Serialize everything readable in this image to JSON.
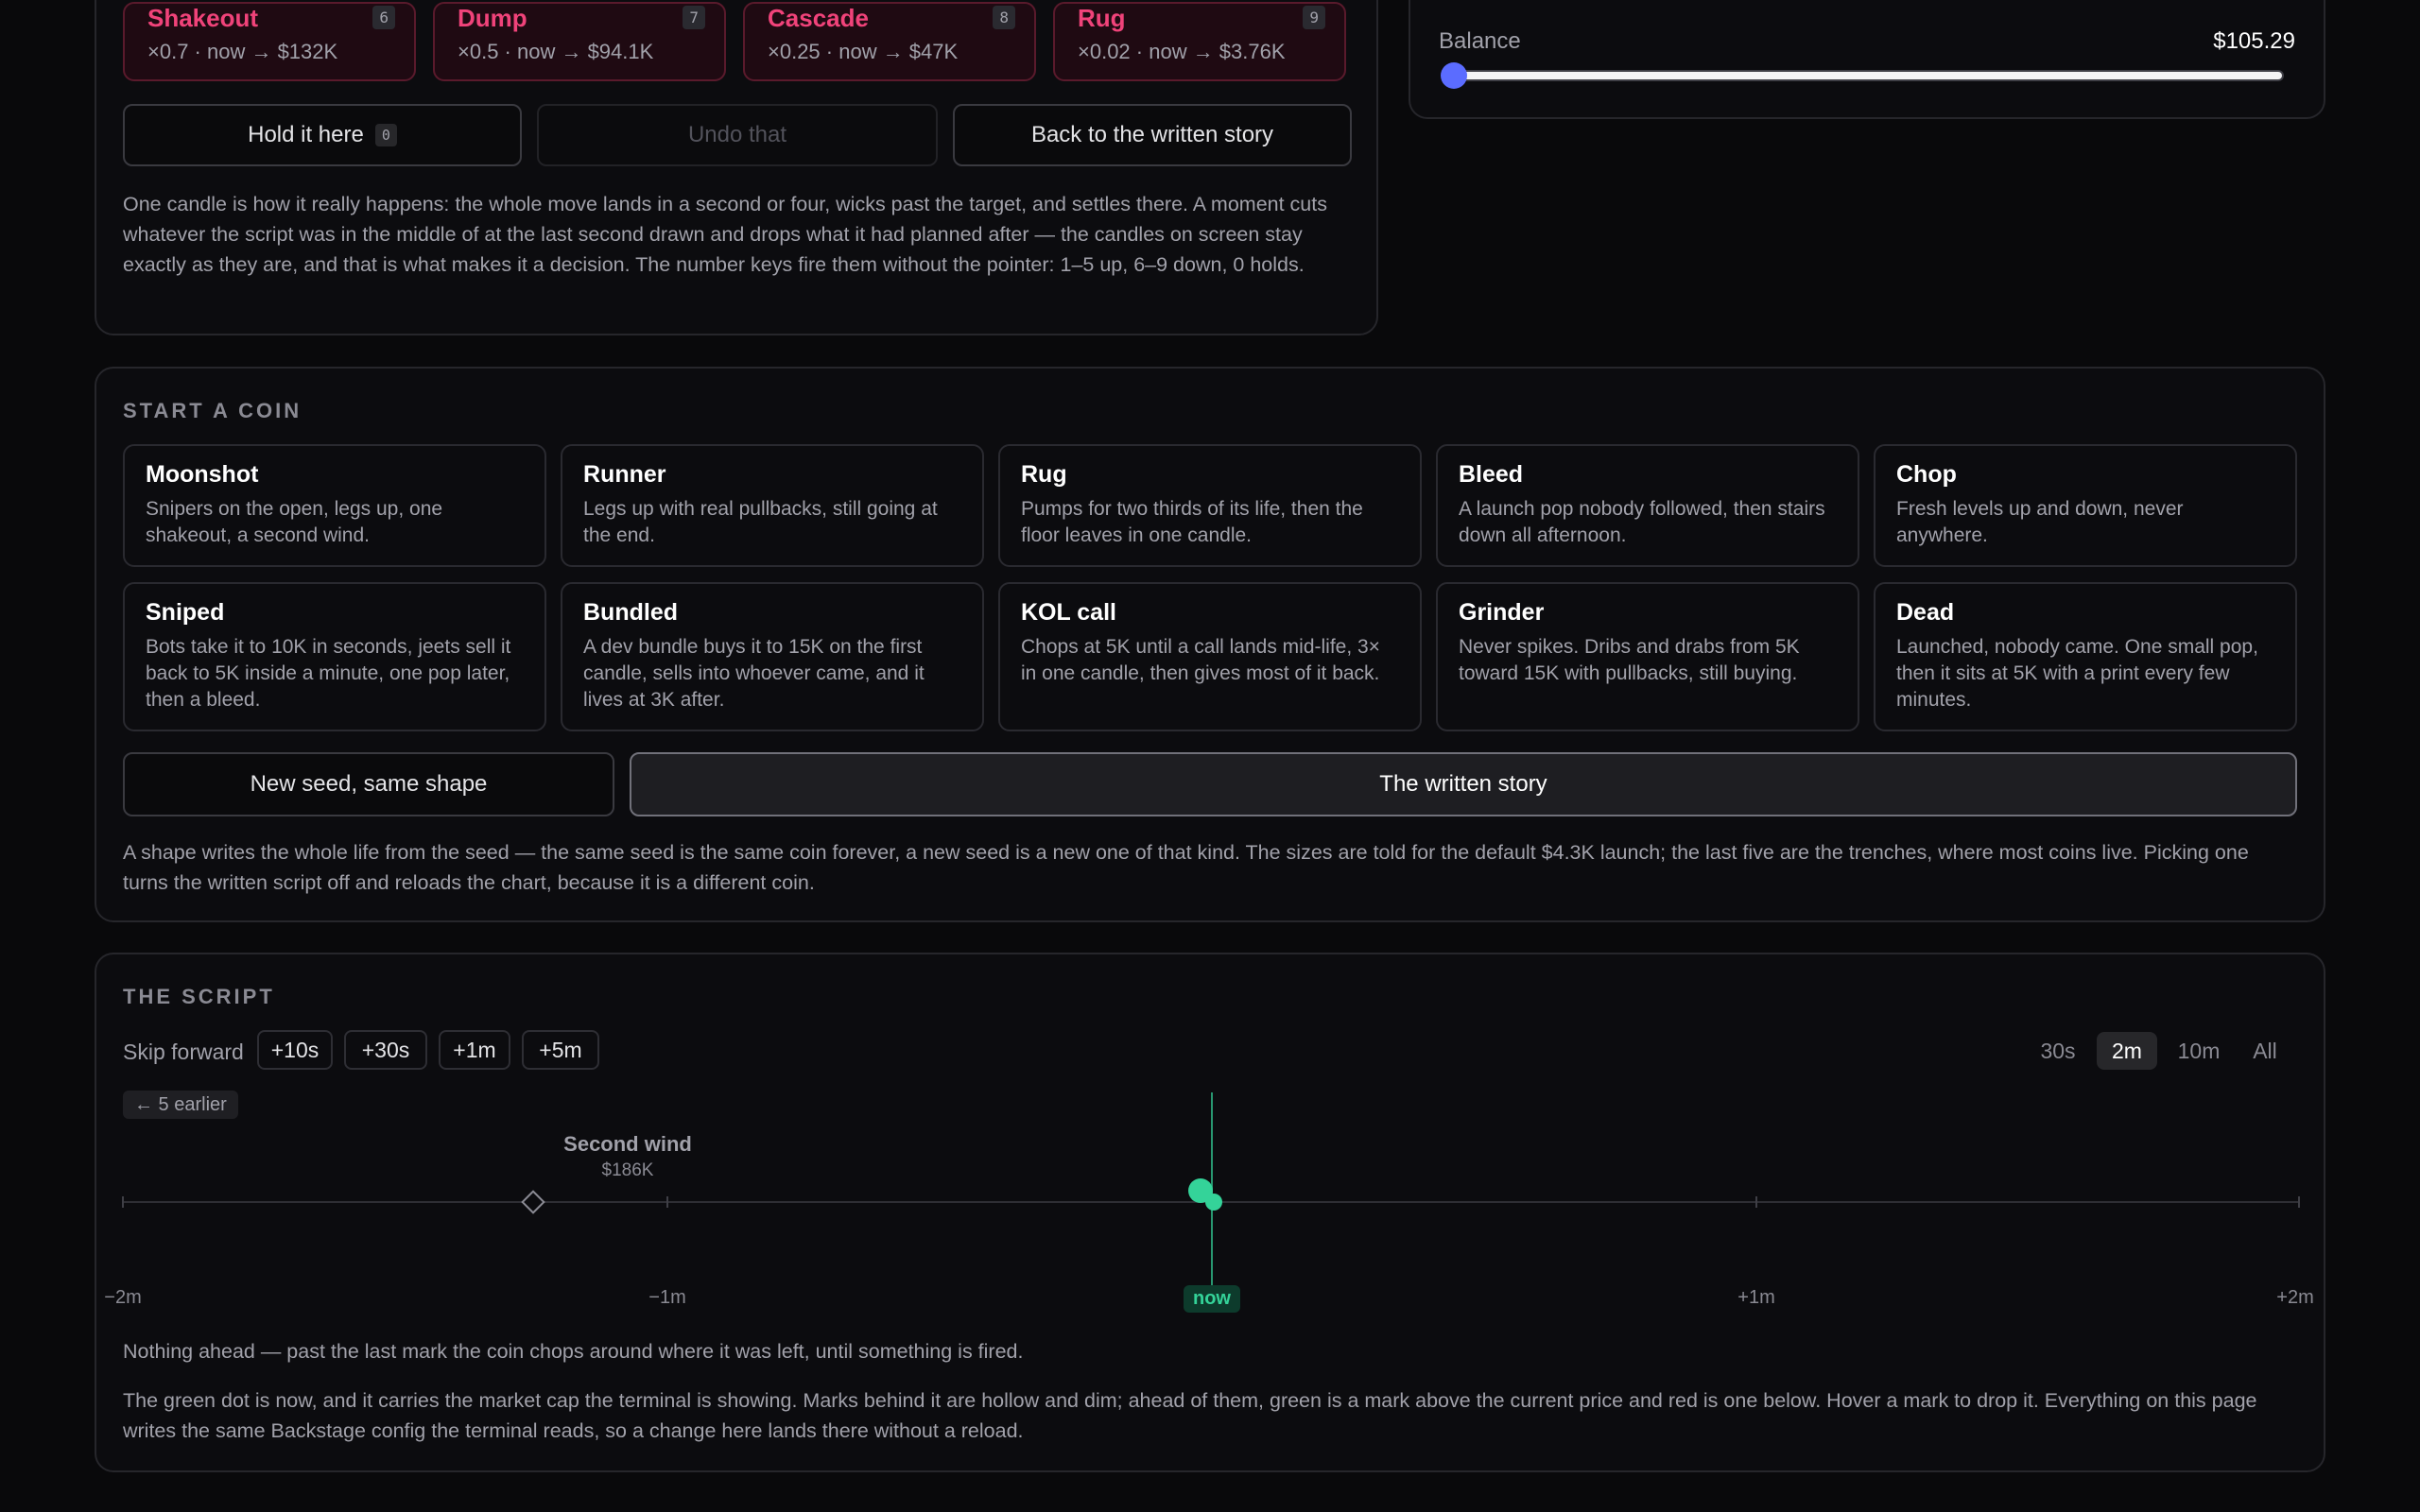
{
  "moments": [
    {
      "name": "Shakeout",
      "key": "6",
      "desc": "×0.7 · now → $132K"
    },
    {
      "name": "Dump",
      "key": "7",
      "desc": "×0.5 · now → $94.1K"
    },
    {
      "name": "Cascade",
      "key": "8",
      "desc": "×0.25 · now → $47K"
    },
    {
      "name": "Rug",
      "key": "9",
      "desc": "×0.02 · now → $3.76K"
    }
  ],
  "moment_actions": {
    "hold_label": "Hold it here",
    "hold_key": "0",
    "undo_label": "Undo that",
    "back_label": "Back to the written story"
  },
  "moment_note": "One candle is how it really happens: the whole move lands in a second or four, wicks past the target, and settles there. A moment cuts whatever the script was in the middle of at the last second drawn and drops what it had planned after — the candles on screen stay exactly as they are, and that is what makes it a decision. The number keys fire them without the pointer: 1–5 up, 6–9 down, 0 holds.",
  "balance": {
    "label": "Balance",
    "value": "$105.29",
    "slider_fraction": 0.0,
    "accent": "#5b6cff"
  },
  "shapes": {
    "title": "START A COIN",
    "cards": [
      {
        "title": "Moonshot",
        "desc": "Snipers on the open, legs up, one shakeout, a second wind."
      },
      {
        "title": "Runner",
        "desc": "Legs up with real pullbacks, still going at the end."
      },
      {
        "title": "Rug",
        "desc": "Pumps for two thirds of its life, then the floor leaves in one candle."
      },
      {
        "title": "Bleed",
        "desc": "A launch pop nobody followed, then stairs down all afternoon."
      },
      {
        "title": "Chop",
        "desc": "Fresh levels up and down, never anywhere."
      },
      {
        "title": "Sniped",
        "desc": "Bots take it to 10K in seconds, jeets sell it back to 5K inside a minute, one pop later, then a bleed."
      },
      {
        "title": "Bundled",
        "desc": "A dev bundle buys it to 15K on the first candle, sells into whoever came, and it lives at 3K after."
      },
      {
        "title": "KOL call",
        "desc": "Chops at 5K until a call lands mid-life, 3× in one candle, then gives most of it back."
      },
      {
        "title": "Grinder",
        "desc": "Never spikes. Dribs and drabs from 5K toward 15K with pullbacks, still buying."
      },
      {
        "title": "Dead",
        "desc": "Launched, nobody came. One small pop, then it sits at 5K with a print every few minutes."
      }
    ],
    "new_seed_label": "New seed, same shape",
    "written_story_label": "The written story",
    "note": "A shape writes the whole life from the seed — the same seed is the same coin forever, a new seed is a new one of that kind. The sizes are told for the default $4.3K launch; the last five are the trenches, where most coins live. Picking one turns the written script off and reloads the chart, because it is a different coin."
  },
  "script": {
    "title": "THE SCRIPT",
    "skip_label": "Skip forward",
    "skip_buttons": [
      "+10s",
      "+30s",
      "+1m",
      "+5m"
    ],
    "ranges": [
      "30s",
      "2m",
      "10m",
      "All"
    ],
    "active_range": "2m",
    "earlier_label": "← 5 earlier",
    "ticks": [
      "−2m",
      "−1m",
      "+1m",
      "+2m"
    ],
    "now_label": "now",
    "mark": {
      "title": "Second wind",
      "price": "$186K"
    },
    "empty_note": "Nothing ahead — past the last mark the coin chops around where it was left, until something is fired.",
    "legend_note": "The green dot is now, and it carries the market cap the terminal is showing. Marks behind it are hollow and dim; ahead of them, green is a mark above the current price and red is one below. Hover a mark to drop it. Everything on this page writes the same Backstage config the terminal reads, so a change here lands there without a reload.",
    "now_color": "#34d399"
  }
}
